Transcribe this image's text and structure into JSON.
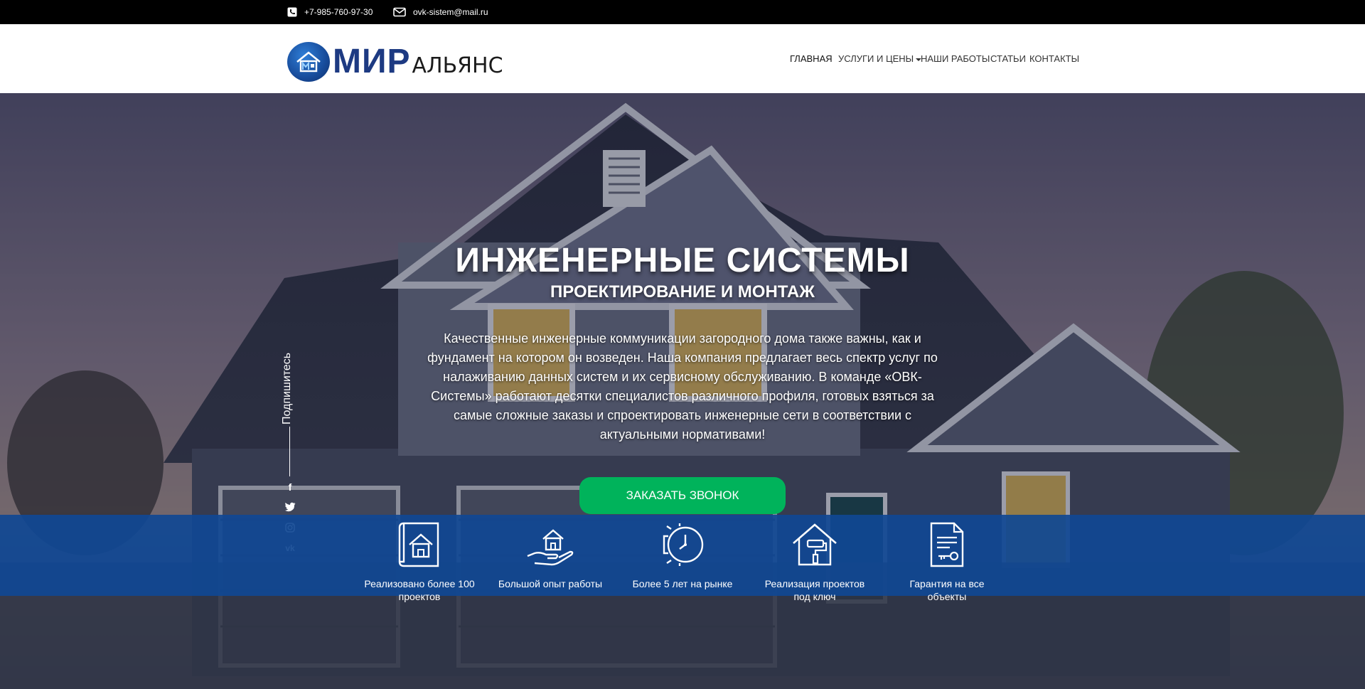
{
  "topbar": {
    "phone": "+7-985-760-97-30",
    "email": "ovk-sistem@mail.ru",
    "phone_icon": "phone-icon",
    "email_icon": "envelope-icon"
  },
  "logo": {
    "mir": "МИР",
    "rest": "АЛЬЯНС"
  },
  "nav": {
    "items": [
      "ГЛАВНАЯ",
      "УСЛУГИ И ЦЕНЫ",
      "НАШИ РАБОТЫ",
      "СТАТЬИ",
      "КОНТАКТЫ"
    ]
  },
  "hero": {
    "title": "ИНЖЕНЕРНЫЕ СИСТЕМЫ",
    "subtitle": "ПРОЕКТИРОВАНИЕ И МОНТАЖ",
    "text": "Качественные инженерные коммуникации загородного дома также важны, как и фундамент на котором он возведен. Наша компания предлагает весь спектр услуг по налаживанию данных систем и их сервисному обслуживанию. В команде «ОВК-Системы» работают десятки специалистов различного профиля, готовых взяться за самые сложные заказы и спроектировать инженерные сети в соответствии с актуальными нормативами!",
    "cta": "ЗАКАЗАТЬ ЗВОНОК"
  },
  "social": {
    "label": "Подпишитесь",
    "icons": [
      "facebook-icon",
      "twitter-icon",
      "instagram-icon",
      "vk-icon"
    ],
    "vk_text": "vk",
    "fb_text": "f"
  },
  "features": [
    {
      "icon": "house-blueprint-icon",
      "label": "Реализовано более 100 проектов"
    },
    {
      "icon": "hand-house-icon",
      "label": "Большой опыт работы"
    },
    {
      "icon": "clock-gear-icon",
      "label": "Более 5 лет на рынке"
    },
    {
      "icon": "house-roller-icon",
      "label": "Реализация проектов под ключ"
    },
    {
      "icon": "document-key-icon",
      "label": "Гарантия на все объекты"
    }
  ],
  "colors": {
    "accent_green": "#00b35b",
    "feature_blue": "#104894",
    "brand_blue": "#1d3a82"
  }
}
